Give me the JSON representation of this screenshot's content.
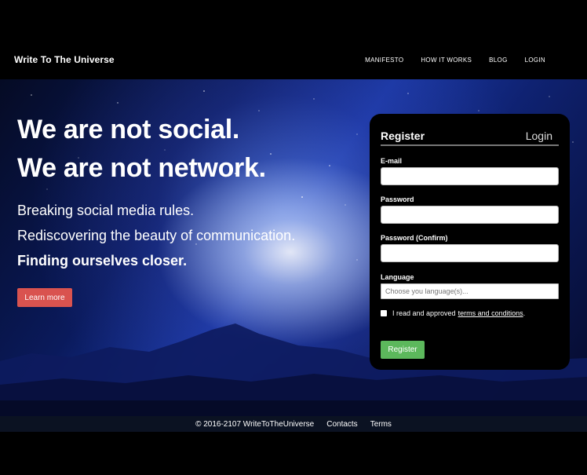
{
  "nav": {
    "brand": "Write To The Universe",
    "links": [
      "MANIFESTO",
      "HOW IT WORKS",
      "BLOG",
      "LOGIN"
    ]
  },
  "hero": {
    "headline_1": "We are not social.",
    "headline_2": "We are not network.",
    "tagline_1": "Breaking social media rules.",
    "tagline_2": "Rediscovering the beauty of communication.",
    "tagline_3": "Finding ourselves closer.",
    "learn_more": "Learn more"
  },
  "form": {
    "tab_register": "Register",
    "tab_login": "Login",
    "email_label": "E-mail",
    "email_value": "",
    "password_label": "Password",
    "password_value": "",
    "password_confirm_label": "Password (Confirm)",
    "password_confirm_value": "",
    "language_label": "Language",
    "language_placeholder": "Choose you language(s)...",
    "terms_prefix": "I read and approved",
    "terms_link": "terms and conditions",
    "terms_suffix": ".",
    "terms_checked": false,
    "register_button": "Register"
  },
  "footer": {
    "copyright": "© 2016-2107 WriteToTheUniverse",
    "contacts": "Contacts",
    "terms": "Terms"
  },
  "colors": {
    "learn_more": "#d9534f",
    "register": "#5cb85c",
    "panel": "#000000"
  }
}
